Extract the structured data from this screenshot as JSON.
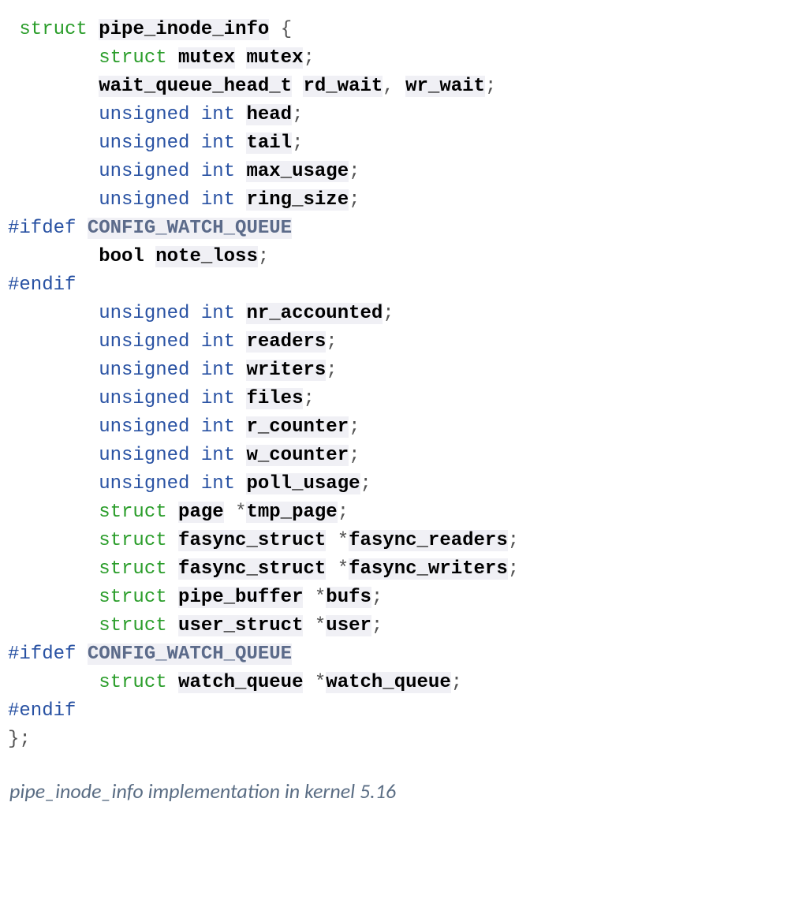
{
  "code": {
    "lines": [
      {
        "indent": 1,
        "parts": [
          {
            "cls": "kw-struct",
            "t": "struct"
          },
          {
            "cls": "sp",
            "t": " "
          },
          {
            "cls": "ident",
            "t": "pipe_inode_info"
          },
          {
            "cls": "sp",
            "t": " "
          },
          {
            "cls": "punct",
            "t": "{"
          }
        ]
      },
      {
        "indent": 8,
        "parts": [
          {
            "cls": "kw-struct",
            "t": "struct"
          },
          {
            "cls": "sp",
            "t": " "
          },
          {
            "cls": "typeident",
            "t": "mutex"
          },
          {
            "cls": "sp",
            "t": " "
          },
          {
            "cls": "ident",
            "t": "mutex"
          },
          {
            "cls": "semi",
            "t": ";"
          }
        ]
      },
      {
        "indent": 8,
        "parts": [
          {
            "cls": "typeident",
            "t": "wait_queue_head_t"
          },
          {
            "cls": "sp",
            "t": " "
          },
          {
            "cls": "ident",
            "t": "rd_wait"
          },
          {
            "cls": "punct",
            "t": ","
          },
          {
            "cls": "sp",
            "t": " "
          },
          {
            "cls": "ident",
            "t": "wr_wait"
          },
          {
            "cls": "semi",
            "t": ";"
          }
        ]
      },
      {
        "indent": 8,
        "parts": [
          {
            "cls": "kw-type",
            "t": "unsigned"
          },
          {
            "cls": "sp",
            "t": " "
          },
          {
            "cls": "kw-type",
            "t": "int"
          },
          {
            "cls": "sp",
            "t": " "
          },
          {
            "cls": "ident",
            "t": "head"
          },
          {
            "cls": "semi",
            "t": ";"
          }
        ]
      },
      {
        "indent": 8,
        "parts": [
          {
            "cls": "kw-type",
            "t": "unsigned"
          },
          {
            "cls": "sp",
            "t": " "
          },
          {
            "cls": "kw-type",
            "t": "int"
          },
          {
            "cls": "sp",
            "t": " "
          },
          {
            "cls": "ident",
            "t": "tail"
          },
          {
            "cls": "semi",
            "t": ";"
          }
        ]
      },
      {
        "indent": 8,
        "parts": [
          {
            "cls": "kw-type",
            "t": "unsigned"
          },
          {
            "cls": "sp",
            "t": " "
          },
          {
            "cls": "kw-type",
            "t": "int"
          },
          {
            "cls": "sp",
            "t": " "
          },
          {
            "cls": "ident",
            "t": "max_usage"
          },
          {
            "cls": "semi",
            "t": ";"
          }
        ]
      },
      {
        "indent": 8,
        "parts": [
          {
            "cls": "kw-type",
            "t": "unsigned"
          },
          {
            "cls": "sp",
            "t": " "
          },
          {
            "cls": "kw-type",
            "t": "int"
          },
          {
            "cls": "sp",
            "t": " "
          },
          {
            "cls": "ident",
            "t": "ring_size"
          },
          {
            "cls": "semi",
            "t": ";"
          }
        ]
      },
      {
        "indent": 0,
        "parts": [
          {
            "cls": "preproc",
            "t": "#ifdef"
          },
          {
            "cls": "sp",
            "t": " "
          },
          {
            "cls": "macroname",
            "t": "CONFIG_WATCH_QUEUE"
          }
        ]
      },
      {
        "indent": 8,
        "parts": [
          {
            "cls": "kw-bool",
            "t": "bool"
          },
          {
            "cls": "sp",
            "t": " "
          },
          {
            "cls": "ident",
            "t": "note_loss"
          },
          {
            "cls": "semi",
            "t": ";"
          }
        ]
      },
      {
        "indent": 0,
        "parts": [
          {
            "cls": "preproc",
            "t": "#endif"
          }
        ]
      },
      {
        "indent": 8,
        "parts": [
          {
            "cls": "kw-type",
            "t": "unsigned"
          },
          {
            "cls": "sp",
            "t": " "
          },
          {
            "cls": "kw-type",
            "t": "int"
          },
          {
            "cls": "sp",
            "t": " "
          },
          {
            "cls": "ident",
            "t": "nr_accounted"
          },
          {
            "cls": "semi",
            "t": ";"
          }
        ]
      },
      {
        "indent": 8,
        "parts": [
          {
            "cls": "kw-type",
            "t": "unsigned"
          },
          {
            "cls": "sp",
            "t": " "
          },
          {
            "cls": "kw-type",
            "t": "int"
          },
          {
            "cls": "sp",
            "t": " "
          },
          {
            "cls": "ident",
            "t": "readers"
          },
          {
            "cls": "semi",
            "t": ";"
          }
        ]
      },
      {
        "indent": 8,
        "parts": [
          {
            "cls": "kw-type",
            "t": "unsigned"
          },
          {
            "cls": "sp",
            "t": " "
          },
          {
            "cls": "kw-type",
            "t": "int"
          },
          {
            "cls": "sp",
            "t": " "
          },
          {
            "cls": "ident",
            "t": "writers"
          },
          {
            "cls": "semi",
            "t": ";"
          }
        ]
      },
      {
        "indent": 8,
        "parts": [
          {
            "cls": "kw-type",
            "t": "unsigned"
          },
          {
            "cls": "sp",
            "t": " "
          },
          {
            "cls": "kw-type",
            "t": "int"
          },
          {
            "cls": "sp",
            "t": " "
          },
          {
            "cls": "ident",
            "t": "files"
          },
          {
            "cls": "semi",
            "t": ";"
          }
        ]
      },
      {
        "indent": 8,
        "parts": [
          {
            "cls": "kw-type",
            "t": "unsigned"
          },
          {
            "cls": "sp",
            "t": " "
          },
          {
            "cls": "kw-type",
            "t": "int"
          },
          {
            "cls": "sp",
            "t": " "
          },
          {
            "cls": "ident",
            "t": "r_counter"
          },
          {
            "cls": "semi",
            "t": ";"
          }
        ]
      },
      {
        "indent": 8,
        "parts": [
          {
            "cls": "kw-type",
            "t": "unsigned"
          },
          {
            "cls": "sp",
            "t": " "
          },
          {
            "cls": "kw-type",
            "t": "int"
          },
          {
            "cls": "sp",
            "t": " "
          },
          {
            "cls": "ident",
            "t": "w_counter"
          },
          {
            "cls": "semi",
            "t": ";"
          }
        ]
      },
      {
        "indent": 8,
        "parts": [
          {
            "cls": "kw-type",
            "t": "unsigned"
          },
          {
            "cls": "sp",
            "t": " "
          },
          {
            "cls": "kw-type",
            "t": "int"
          },
          {
            "cls": "sp",
            "t": " "
          },
          {
            "cls": "ident",
            "t": "poll_usage"
          },
          {
            "cls": "semi",
            "t": ";"
          }
        ]
      },
      {
        "indent": 8,
        "parts": [
          {
            "cls": "kw-struct",
            "t": "struct"
          },
          {
            "cls": "sp",
            "t": " "
          },
          {
            "cls": "typeident",
            "t": "page"
          },
          {
            "cls": "sp",
            "t": " "
          },
          {
            "cls": "star",
            "t": "*"
          },
          {
            "cls": "ident",
            "t": "tmp_page"
          },
          {
            "cls": "semi",
            "t": ";"
          }
        ]
      },
      {
        "indent": 8,
        "parts": [
          {
            "cls": "kw-struct",
            "t": "struct"
          },
          {
            "cls": "sp",
            "t": " "
          },
          {
            "cls": "typeident",
            "t": "fasync_struct"
          },
          {
            "cls": "sp",
            "t": " "
          },
          {
            "cls": "star",
            "t": "*"
          },
          {
            "cls": "ident",
            "t": "fasync_readers"
          },
          {
            "cls": "semi",
            "t": ";"
          }
        ]
      },
      {
        "indent": 8,
        "parts": [
          {
            "cls": "kw-struct",
            "t": "struct"
          },
          {
            "cls": "sp",
            "t": " "
          },
          {
            "cls": "typeident",
            "t": "fasync_struct"
          },
          {
            "cls": "sp",
            "t": " "
          },
          {
            "cls": "star",
            "t": "*"
          },
          {
            "cls": "ident",
            "t": "fasync_writers"
          },
          {
            "cls": "semi",
            "t": ";"
          }
        ]
      },
      {
        "indent": 8,
        "parts": [
          {
            "cls": "kw-struct",
            "t": "struct"
          },
          {
            "cls": "sp",
            "t": " "
          },
          {
            "cls": "typeident",
            "t": "pipe_buffer"
          },
          {
            "cls": "sp",
            "t": " "
          },
          {
            "cls": "star",
            "t": "*"
          },
          {
            "cls": "ident",
            "t": "bufs"
          },
          {
            "cls": "semi",
            "t": ";"
          }
        ]
      },
      {
        "indent": 8,
        "parts": [
          {
            "cls": "kw-struct",
            "t": "struct"
          },
          {
            "cls": "sp",
            "t": " "
          },
          {
            "cls": "typeident",
            "t": "user_struct"
          },
          {
            "cls": "sp",
            "t": " "
          },
          {
            "cls": "star",
            "t": "*"
          },
          {
            "cls": "ident",
            "t": "user"
          },
          {
            "cls": "semi",
            "t": ";"
          }
        ]
      },
      {
        "indent": 0,
        "parts": [
          {
            "cls": "preproc",
            "t": "#ifdef"
          },
          {
            "cls": "sp",
            "t": " "
          },
          {
            "cls": "macroname",
            "t": "CONFIG_WATCH_QUEUE"
          }
        ]
      },
      {
        "indent": 8,
        "parts": [
          {
            "cls": "kw-struct",
            "t": "struct"
          },
          {
            "cls": "sp",
            "t": " "
          },
          {
            "cls": "typeident",
            "t": "watch_queue"
          },
          {
            "cls": "sp",
            "t": " "
          },
          {
            "cls": "star",
            "t": "*"
          },
          {
            "cls": "ident",
            "t": "watch_queue"
          },
          {
            "cls": "semi",
            "t": ";"
          }
        ]
      },
      {
        "indent": 0,
        "parts": [
          {
            "cls": "preproc",
            "t": "#endif"
          }
        ]
      },
      {
        "indent": 0,
        "parts": [
          {
            "cls": "punct",
            "t": "};"
          }
        ]
      }
    ]
  },
  "caption": "pipe_inode_info implementation in kernel 5.16"
}
